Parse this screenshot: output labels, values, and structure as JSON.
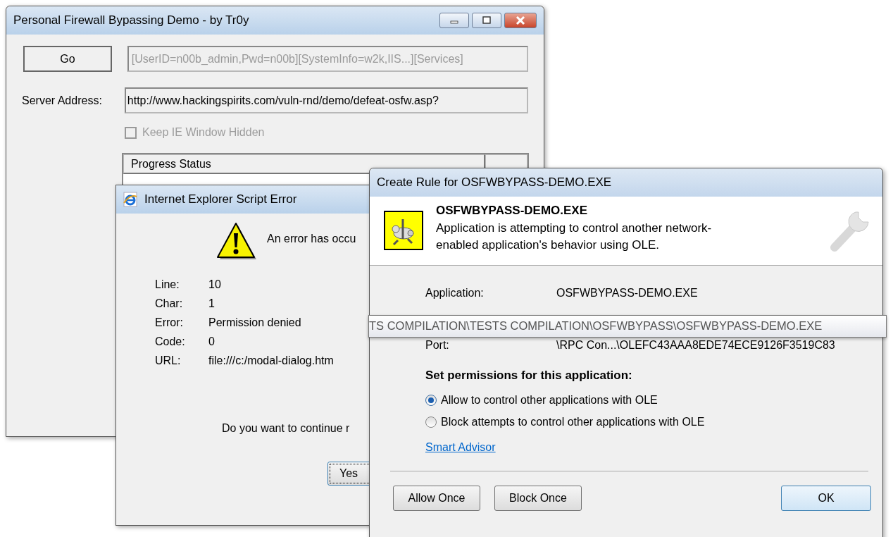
{
  "main_window": {
    "title": "Personal Firewall Bypassing Demo - by Tr0y",
    "go_button": "Go",
    "response_field": {
      "value": "[UserID=n00b_admin,Pwd=n00b][SystemInfo=w2k,IIS...][Services]",
      "disabled": true
    },
    "server_address": {
      "label": "Server Address:",
      "value": "http://www.hackingspirits.com/vuln-rnd/demo/defeat-osfw.asp?"
    },
    "keep_hidden": {
      "label": "Keep IE Window Hidden",
      "checked": false,
      "disabled": true
    },
    "progress_list": {
      "columns": [
        "Progress Status"
      ]
    }
  },
  "script_error_dialog": {
    "title": "Internet Explorer Script Error",
    "message": "An error has occu",
    "details": [
      {
        "label": "Line:",
        "value": "10"
      },
      {
        "label": "Char:",
        "value": "1"
      },
      {
        "label": "Error:",
        "value": "Permission denied"
      },
      {
        "label": "Code:",
        "value": "0"
      },
      {
        "label": "URL:",
        "value": "file:///c:/modal-dialog.htm"
      }
    ],
    "question": "Do you want to continue r",
    "buttons": [
      {
        "label": "Yes",
        "focused": true
      }
    ]
  },
  "create_rule_dialog": {
    "title": "Create Rule for OSFWBYPASS-DEMO.EXE",
    "app_name": "OSFWBYPASS-DEMO.EXE",
    "description": "Application is attempting to control another network-enabled application's behavior using OLE.",
    "details": [
      {
        "label": "Application:",
        "value": "OSFWBYPASS-DEMO.EXE"
      },
      {
        "label": "Port:",
        "value": "\\RPC Con...\\OLEFC43AAA8EDE74ECE9126F3519C83"
      }
    ],
    "tooltip": "TS COMPILATION\\TESTS COMPILATION\\OSFWBYPASS\\OSFWBYPASS-DEMO.EXE",
    "permissions_heading": "Set permissions for this application:",
    "options": [
      {
        "label": "Allow to control other applications with OLE",
        "selected": true
      },
      {
        "label": "Block attempts to control other applications with OLE",
        "selected": false
      }
    ],
    "link": "Smart Advisor",
    "buttons": [
      {
        "label": "Allow Once",
        "kind": "left"
      },
      {
        "label": "Block Once",
        "kind": "left"
      },
      {
        "label": "OK",
        "kind": "default"
      }
    ]
  }
}
